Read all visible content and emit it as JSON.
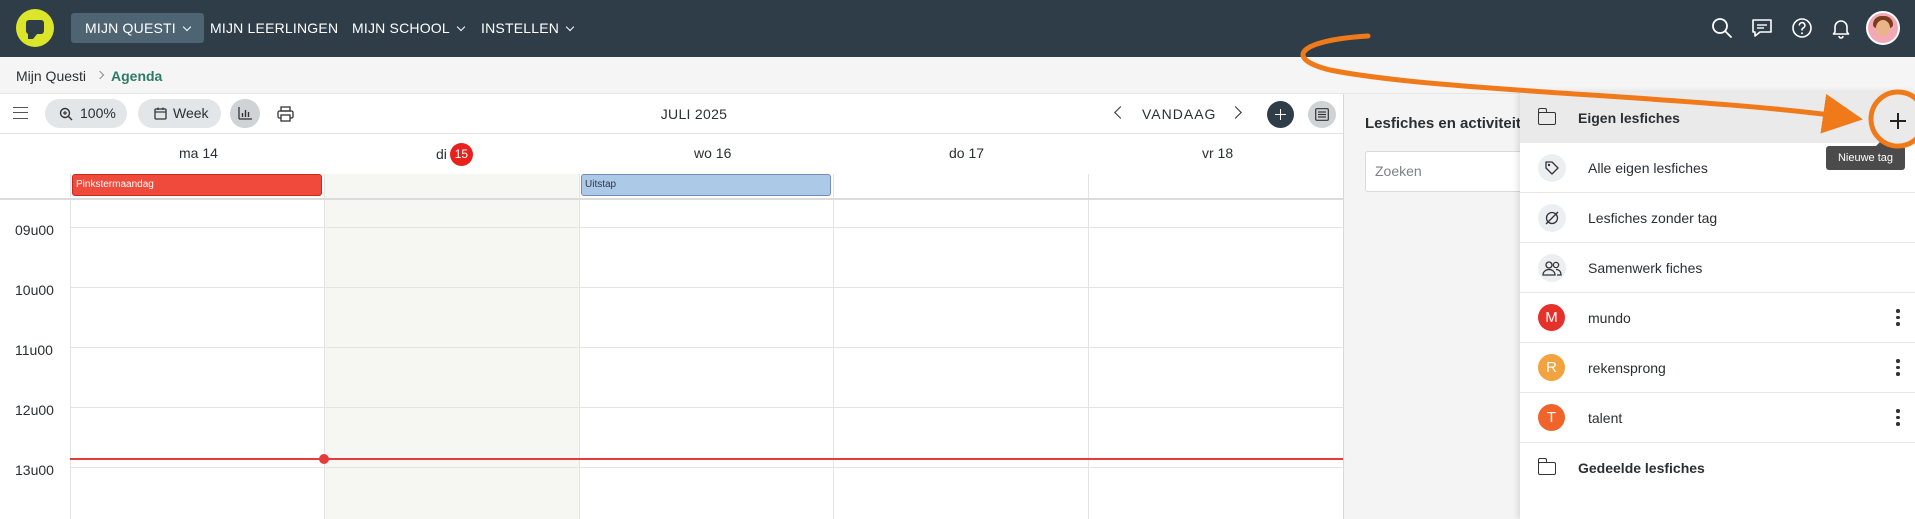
{
  "nav": {
    "items": [
      {
        "label": "MIJN QUESTI",
        "active": true
      },
      {
        "label": "MIJN LEERLINGEN"
      },
      {
        "label": "MIJN SCHOOL"
      },
      {
        "label": "INSTELLEN"
      }
    ],
    "icons": [
      "search-icon",
      "chat-icon",
      "help-icon",
      "bell-icon",
      "avatar"
    ],
    "colors": {
      "bar": "#2f3d48",
      "logo": "#dbe62b"
    }
  },
  "breadcrumb": {
    "parent": "Mijn Questi",
    "current": "Agenda"
  },
  "toolbar": {
    "zoom": "100%",
    "view": "Week",
    "month_title": "JULI 2025",
    "today_label": "VANDAAG"
  },
  "calendar": {
    "days": [
      {
        "label": "ma 14"
      },
      {
        "label": "di",
        "badge": "15",
        "today": true
      },
      {
        "label": "wo 16"
      },
      {
        "label": "do 17"
      },
      {
        "label": "vr 18"
      }
    ],
    "events": [
      {
        "label": "Pinkstermaandag",
        "color": "#f04a3c"
      },
      {
        "label": "Uitstap",
        "color": "#adc9e8"
      }
    ],
    "hours": [
      "09u00",
      "10u00",
      "11u00",
      "12u00",
      "13u00"
    ],
    "now_line_color": "#e43b3b"
  },
  "panel": {
    "title": "Lesfiches en activiteit",
    "search_placeholder": "Zoeken"
  },
  "dropdown": {
    "header": "Eigen lesfiches",
    "items": [
      {
        "label": "Alle eigen lesfiches",
        "icon": "tag-icon"
      },
      {
        "label": "Lesfiches zonder tag",
        "icon": "no-tag-icon"
      },
      {
        "label": "Samenwerk fiches",
        "icon": "people-icon"
      },
      {
        "label": "mundo",
        "letter": "M",
        "color": "#e6312b"
      },
      {
        "label": "rekensprong",
        "letter": "R",
        "color": "#f2a23f"
      },
      {
        "label": "talent",
        "letter": "T",
        "color": "#f0642b"
      }
    ],
    "footer": "Gedeelde lesfiches",
    "add_tooltip": "Nieuwe tag",
    "annotation_color": "#f07a1a"
  }
}
